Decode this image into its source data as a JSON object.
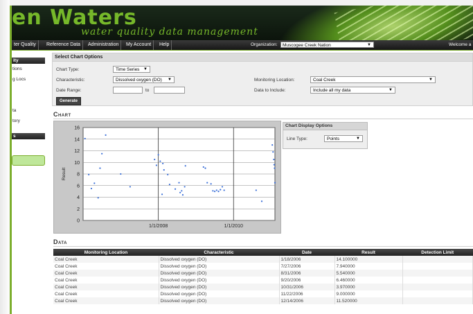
{
  "header": {
    "brand": "en Waters",
    "tagline": "water quality data management"
  },
  "nav": {
    "items": [
      "ter Quality",
      "Reference Data",
      "Administration",
      "My Account",
      "Help"
    ],
    "org_label": "Organization:",
    "org_value": "Muscogee Creek Nation",
    "welcome": "Welcome a"
  },
  "sidebar": {
    "head1": "ity",
    "items1": [
      "tions",
      "g Locs",
      "",
      "",
      "ta",
      "tory"
    ],
    "head2": "s"
  },
  "chart_options": {
    "title": "Select Chart Options",
    "chart_type_label": "Chart Type:",
    "chart_type_value": "Time Series",
    "characteristic_label": "Characteristic:",
    "characteristic_value": "Dissolved oxygen (DO)",
    "date_range_label": "Date Range:",
    "date_range_to": "to",
    "monitoring_location_label": "Monitoring Location:",
    "monitoring_location_value": "Coal Creek",
    "data_include_label": "Data to Include:",
    "data_include_value": "Include all my data",
    "generate_label": "Generate"
  },
  "chart_section_title": "Chart",
  "display_options": {
    "title": "Chart Display Options",
    "line_type_label": "Line Type:",
    "line_type_value": "Points"
  },
  "chart_data": {
    "type": "scatter",
    "ylabel": "Result",
    "ylim": [
      0,
      16
    ],
    "yticks": [
      "0",
      "2",
      "4",
      "6",
      "8",
      "10",
      "12",
      "14",
      "16"
    ],
    "xticks": [
      {
        "label": "1/1/2008",
        "year": 2008.0
      },
      {
        "label": "1/1/2010",
        "year": 2010.0
      }
    ],
    "xlim": [
      2006.0,
      2011.1
    ],
    "grid": true,
    "points": [
      [
        2006.05,
        14.1
      ],
      [
        2006.15,
        7.9
      ],
      [
        2006.22,
        5.5
      ],
      [
        2006.3,
        6.4
      ],
      [
        2006.4,
        3.9
      ],
      [
        2006.45,
        9.0
      ],
      [
        2006.5,
        11.5
      ],
      [
        2006.6,
        14.7
      ],
      [
        2007.0,
        8.0
      ],
      [
        2007.25,
        5.8
      ],
      [
        2007.9,
        10.5
      ],
      [
        2007.95,
        9.5
      ],
      [
        2008.0,
        11.3
      ],
      [
        2008.05,
        10.2
      ],
      [
        2008.1,
        4.5
      ],
      [
        2008.12,
        9.8
      ],
      [
        2008.15,
        8.7
      ],
      [
        2008.25,
        7.9
      ],
      [
        2008.3,
        6.2
      ],
      [
        2008.45,
        5.4
      ],
      [
        2008.55,
        6.5
      ],
      [
        2008.58,
        4.8
      ],
      [
        2008.62,
        5.1
      ],
      [
        2008.65,
        4.4
      ],
      [
        2008.7,
        5.8
      ],
      [
        2008.72,
        9.4
      ],
      [
        2009.2,
        9.2
      ],
      [
        2009.25,
        9.0
      ],
      [
        2009.3,
        6.5
      ],
      [
        2009.4,
        6.3
      ],
      [
        2009.45,
        5.1
      ],
      [
        2009.5,
        5.0
      ],
      [
        2009.55,
        5.2
      ],
      [
        2009.6,
        5.0
      ],
      [
        2009.65,
        5.3
      ],
      [
        2009.7,
        5.8
      ],
      [
        2009.75,
        5.2
      ],
      [
        2010.6,
        5.2
      ],
      [
        2010.75,
        3.3
      ],
      [
        2011.03,
        13.0
      ],
      [
        2011.05,
        11.8
      ],
      [
        2011.07,
        10.5
      ],
      [
        2011.08,
        9.6
      ],
      [
        2011.09,
        9.0
      ],
      [
        2011.1,
        6.5
      ]
    ]
  },
  "data_section_title": "Data",
  "table": {
    "headers": [
      "Monitoring Location",
      "Characteristic",
      "Date",
      "Result",
      "Detection Limit"
    ],
    "rows": [
      [
        "Coal Creek",
        "Dissolved oxygen (DO)",
        "1/18/2006",
        "14.100000",
        ""
      ],
      [
        "Coal Creek",
        "Dissolved oxygen (DO)",
        "7/27/2006",
        "7.940000",
        ""
      ],
      [
        "Coal Creek",
        "Dissolved oxygen (DO)",
        "8/31/2006",
        "5.540000",
        ""
      ],
      [
        "Coal Creek",
        "Dissolved oxygen (DO)",
        "9/20/2006",
        "6.460000",
        ""
      ],
      [
        "Coal Creek",
        "Dissolved oxygen (DO)",
        "10/31/2006",
        "3.970000",
        ""
      ],
      [
        "Coal Creek",
        "Dissolved oxygen (DO)",
        "11/22/2006",
        "9.000000",
        ""
      ],
      [
        "Coal Creek",
        "Dissolved oxygen (DO)",
        "12/14/2006",
        "11.520000",
        ""
      ]
    ]
  },
  "colors": {
    "brand_green": "#76b82a",
    "point_blue": "#3a6fd8"
  }
}
